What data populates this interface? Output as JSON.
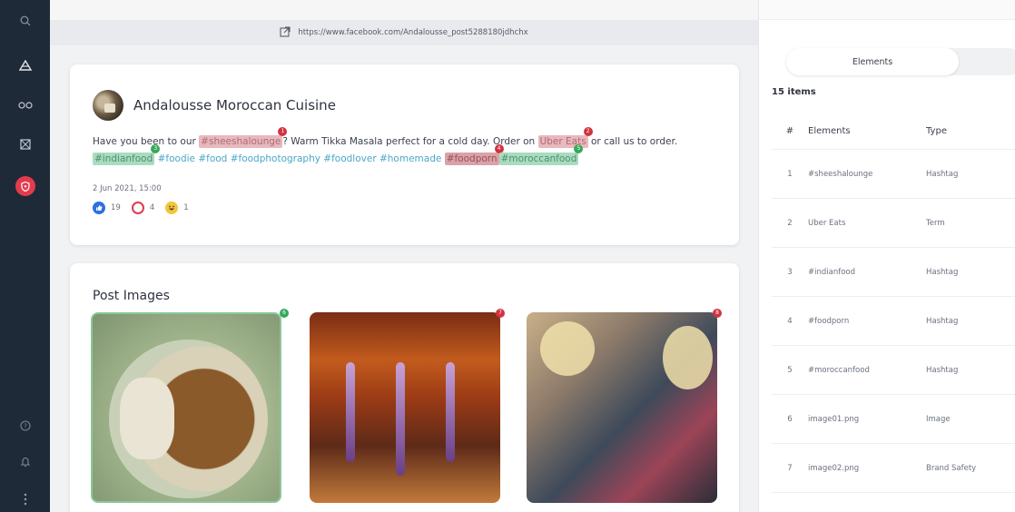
{
  "sidebar": {
    "icons": [
      "search-icon",
      "people-icon",
      "infinity-icon",
      "grid-icon",
      "shield-icon",
      "help-icon",
      "bell-icon",
      "more-icon"
    ]
  },
  "urlbar": {
    "url": "https://www.facebook.com/Andalousse_post5288180jdhchx"
  },
  "post": {
    "title": "Andalousse Moroccan Cuisine",
    "text_1": "Have you been to our ",
    "tag_1": "#sheeshalounge",
    "text_2": "? Warm Tikka Masala perfect for a cold day. Order on ",
    "term_2": "Uber Eats",
    "text_3": " or call us to order.",
    "tag_3": "#indianfood",
    "tag_foodie": "#foodie",
    "tag_food": "#food",
    "tag_foodphotography": "#foodphotography",
    "tag_foodlover": "#foodlover",
    "tag_homemade": "#homemade",
    "tag_4": "#foodporn",
    "tag_5": "#moroccanfood",
    "date": "2 Jun 2021, 15:00",
    "likes": "19",
    "loves": "4",
    "hahas": "1",
    "badges": [
      "1",
      "2",
      "3",
      "4",
      "5"
    ]
  },
  "images": {
    "title": "Post Images",
    "badges": [
      "6",
      "7",
      "8"
    ]
  },
  "panel": {
    "tab_label": "Elements",
    "count": "15 items",
    "headers": [
      "#",
      "Elements",
      "Type"
    ],
    "rows": [
      {
        "num": "1",
        "element": "#sheeshalounge",
        "type": "Hashtag"
      },
      {
        "num": "2",
        "element": "Uber Eats",
        "type": "Term"
      },
      {
        "num": "3",
        "element": "#indianfood",
        "type": "Hashtag"
      },
      {
        "num": "4",
        "element": "#foodporn",
        "type": "Hashtag"
      },
      {
        "num": "5",
        "element": "#moroccanfood",
        "type": "Hashtag"
      },
      {
        "num": "6",
        "element": "image01.png",
        "type": "Image"
      },
      {
        "num": "7",
        "element": "image02.png",
        "type": "Brand Safety"
      }
    ]
  },
  "colors": {
    "sidebar": "#1f2a38",
    "accent": "#e33b4e",
    "highlight_red": "#e8b9bd",
    "highlight_green": "#a9dcbf",
    "hashtag": "#4ba7c7"
  }
}
